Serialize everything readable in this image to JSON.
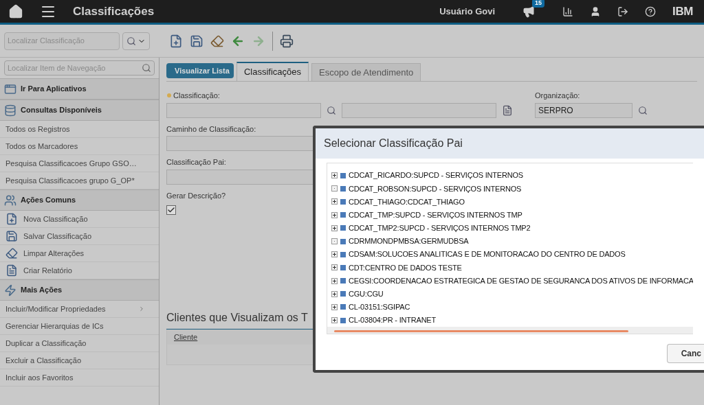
{
  "header": {
    "title": "Classificações",
    "user": "Usuário Govi",
    "notifications": "15",
    "logo": "IBM"
  },
  "toolbar": {
    "search_placeholder": "Localizar Classificação"
  },
  "sidebar": {
    "search_placeholder": "Localizar Item de Navegação",
    "sections": [
      {
        "title": "Ir Para Aplicativos",
        "kind": "apps"
      },
      {
        "title": "Consultas Disponíveis",
        "kind": "queries",
        "items": [
          {
            "label": "Todos os Registros",
            "submenu": false
          },
          {
            "label": "Todos os Marcadores",
            "submenu": false
          },
          {
            "label": "Pesquisa Classificacoes Grupo GSO…",
            "submenu": false
          },
          {
            "label": "Pesquisa Classificacoes grupo G_OP*",
            "submenu": false
          }
        ]
      },
      {
        "title": "Ações Comuns",
        "kind": "actions",
        "items": [
          {
            "label": "Nova Classificação"
          },
          {
            "label": "Salvar Classificação"
          },
          {
            "label": "Limpar Alterações"
          },
          {
            "label": "Criar Relatório"
          }
        ]
      },
      {
        "title": "Mais Ações",
        "kind": "more",
        "items": [
          {
            "label": "Incluir/Modificar Propriedades",
            "submenu": true
          },
          {
            "label": "Gerenciar Hierarquias de ICs",
            "submenu": false
          },
          {
            "label": "Duplicar a Classificação",
            "submenu": false
          },
          {
            "label": "Excluir a Classificação",
            "submenu": false
          },
          {
            "label": "Incluir aos Favoritos",
            "submenu": false
          }
        ]
      }
    ]
  },
  "main": {
    "back_button": "Visualizar Lista",
    "tabs": [
      {
        "label": "Classificações",
        "selected": true
      },
      {
        "label": "Escopo de Atendimento",
        "selected": false
      }
    ],
    "fields": {
      "classification_label": "Classificação:",
      "path_label": "Caminho de Classificação:",
      "parent_label": "Classificação Pai:",
      "generate_label": "Gerar Descrição?",
      "generate_checked": true,
      "org_label": "Organização:",
      "org_value": "SERPRO"
    },
    "clients_title": "Clientes que Visualizam os T",
    "clients_column": "Cliente"
  },
  "dialog": {
    "title": "Selecionar Classificação Pai",
    "items": [
      {
        "label": "CDCAT_RICARDO:SUPCD - SERVIÇOS INTERNOS",
        "has_children": true
      },
      {
        "label": "CDCAT_ROBSON:SUPCD - SERVIÇOS INTERNOS",
        "has_children": false
      },
      {
        "label": "CDCAT_THIAGO:CDCAT_THIAGO",
        "has_children": true
      },
      {
        "label": "CDCAT_TMP:SUPCD - SERVIÇOS INTERNOS TMP",
        "has_children": true
      },
      {
        "label": "CDCAT_TMP2:SUPCD - SERVIÇOS INTERNOS TMP2",
        "has_children": true
      },
      {
        "label": "CDRMMONDPMBSA:GERMUDBSA",
        "has_children": false
      },
      {
        "label": "CDSAM:SOLUCOES ANALITICAS E DE MONITORACAO DO CENTRO DE DADOS",
        "has_children": true
      },
      {
        "label": "CDT:CENTRO DE DADOS TESTE",
        "has_children": true
      },
      {
        "label": "CEGSI:COORDENACAO ESTRATEGICA DE GESTAO DE SEGURANCA DOS ATIVOS DE INFORMACA",
        "has_children": true
      },
      {
        "label": "CGU:CGU",
        "has_children": true
      },
      {
        "label": "CL-03151:SGIPAC",
        "has_children": true
      },
      {
        "label": "CL-03804:PR - INTRANET",
        "has_children": true
      }
    ],
    "cancel_button": "Canc"
  }
}
